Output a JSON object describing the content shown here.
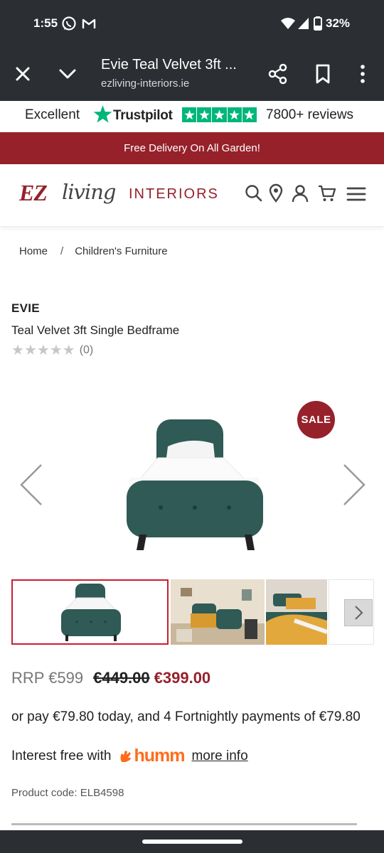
{
  "status_bar": {
    "time": "1:55",
    "battery": "32%",
    "icons": [
      "whatsapp-icon",
      "gmail-icon",
      "wifi-icon",
      "signal-icon",
      "battery-icon"
    ]
  },
  "browser": {
    "tab_title": "Evie Teal Velvet 3ft ...",
    "url": "ezliving-interiors.ie"
  },
  "trustpilot": {
    "label": "Excellent",
    "brand": "Trustpilot",
    "reviews": "7800+ reviews",
    "stars": 5
  },
  "promo": {
    "text": "Free Delivery On All Garden!"
  },
  "logo": {
    "ez": "EZ",
    "living": "living",
    "interiors": "INTERIORS"
  },
  "breadcrumb": {
    "home": "Home",
    "separator": "/",
    "category": "Children's Furniture"
  },
  "product": {
    "brand": "EVIE",
    "name": "Teal Velvet 3ft Single Bedframe",
    "rating_count": "(0)",
    "sale_badge": "SALE",
    "rrp": "RRP €599",
    "was_price": "€449.00",
    "price": "€399.00",
    "installment_text": "or pay €79.80 today, and 4 Fortnightly payments of €79.80",
    "interest_text": "Interest free with",
    "humm_label": "humm",
    "more_info": "more info",
    "product_code": "Product code: ELB4598"
  },
  "colors": {
    "brand_red": "#96212b",
    "trustpilot_green": "#00b67a",
    "humm_orange": "#ff6c1a",
    "bed_teal": "#2f5a55"
  }
}
